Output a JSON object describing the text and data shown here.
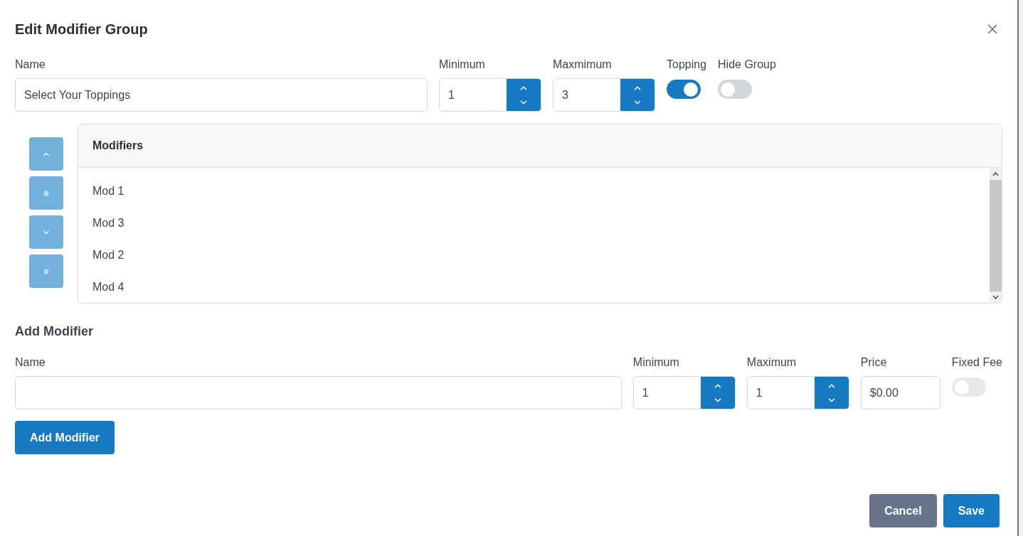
{
  "dialog": {
    "title": "Edit Modifier Group"
  },
  "group": {
    "name": {
      "label": "Name",
      "value": "Select Your Toppings"
    },
    "minimum": {
      "label": "Minimum",
      "value": "1"
    },
    "maximum": {
      "label": "Maxmimum",
      "value": "3"
    },
    "toggles": [
      {
        "label": "Topping",
        "on": true
      },
      {
        "label": "Hide Group",
        "on": false
      }
    ]
  },
  "modifiers": {
    "header": "Modifiers",
    "items": [
      {
        "label": "Mod 1"
      },
      {
        "label": "Mod 3"
      },
      {
        "label": "Mod 2"
      },
      {
        "label": "Mod 4"
      }
    ]
  },
  "add_modifier": {
    "title": "Add Modifier",
    "name": {
      "label": "Name"
    },
    "minimum": {
      "label": "Minimum",
      "value": "1"
    },
    "maximum": {
      "label": "Maximum",
      "value": "1"
    },
    "price": {
      "label": "Price",
      "value": "$0.00"
    },
    "fixed_fee": {
      "label": "Fixed Fee",
      "on": false,
      "disabled": true
    },
    "button": "Add Modifier"
  },
  "buttons": [
    {
      "label": "Cancel",
      "kind": "secondary"
    },
    {
      "label": "Save",
      "kind": "primary"
    }
  ]
}
